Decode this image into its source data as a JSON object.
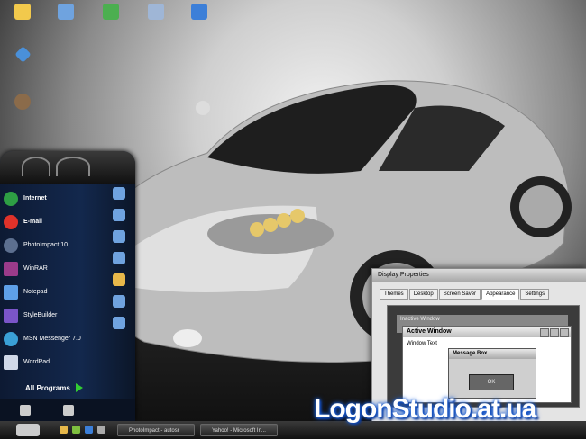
{
  "desktop": {
    "icons": [
      {
        "label": "",
        "icon": "folder-icon",
        "color": "#f2c94c"
      },
      {
        "label": "",
        "icon": "computer-icon",
        "color": "#6fa3df"
      },
      {
        "label": "",
        "icon": "network-icon",
        "color": "#4caf50"
      },
      {
        "label": "",
        "icon": "recycle-bin-icon",
        "color": "#9fb6d6"
      },
      {
        "label": "",
        "icon": "folder-icon",
        "color": "#3c7fd8"
      },
      {
        "label": "",
        "icon": "app-icon",
        "color": "#4a90d9"
      },
      {
        "label": "",
        "icon": "user-icon",
        "color": "#8b6b4a"
      }
    ]
  },
  "start_menu": {
    "items": [
      {
        "title": "Internet",
        "subtitle": "",
        "icon": "browser-icon",
        "color": "#2e9e44"
      },
      {
        "title": "E-mail",
        "subtitle": "",
        "icon": "email-icon",
        "color": "#e0322a"
      },
      {
        "title": "PhotoImpact 10",
        "subtitle": "",
        "icon": "photo-app-icon",
        "color": "#5c6f8f"
      },
      {
        "title": "WinRAR",
        "subtitle": "",
        "icon": "archive-icon",
        "color": "#9b3b8a"
      },
      {
        "title": "Notepad",
        "subtitle": "",
        "icon": "notepad-icon",
        "color": "#5ea0e8"
      },
      {
        "title": "StyleBuilder",
        "subtitle": "",
        "icon": "stylebuilder-icon",
        "color": "#7a55c9"
      },
      {
        "title": "MSN Messenger 7.0",
        "subtitle": "",
        "icon": "messenger-icon",
        "color": "#3aa0d6"
      },
      {
        "title": "WordPad",
        "subtitle": "",
        "icon": "wordpad-icon",
        "color": "#d0d8e8"
      }
    ],
    "all_programs": "All Programs"
  },
  "taskbar": {
    "tasks": [
      {
        "label": "PhotoImpact - autosr"
      },
      {
        "label": "Yahoo! - Microsoft In..."
      }
    ]
  },
  "display_properties": {
    "title": "Display Properties",
    "tabs": [
      "Themes",
      "Desktop",
      "Screen Saver",
      "Appearance",
      "Settings"
    ],
    "selected_tab": "Appearance",
    "inactive_window": "Inactive Window",
    "active_window": "Active Window",
    "window_text": "Window Text",
    "message_box": "Message Box",
    "ok": "OK"
  },
  "watermark": "LogonStudio.at.ua"
}
